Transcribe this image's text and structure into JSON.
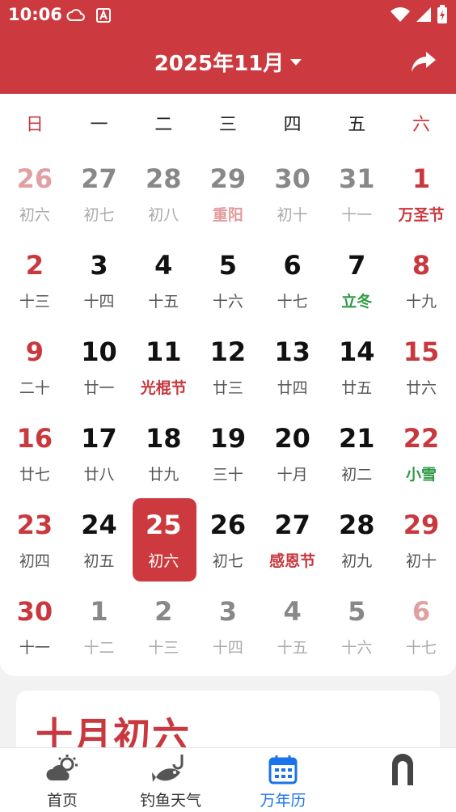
{
  "status": {
    "time": "10:06"
  },
  "header": {
    "title": "2025年11月"
  },
  "colors": {
    "brand": "#cc3a3f",
    "festival": "#c8383e",
    "solar_term": "#2e9a45",
    "nav_active": "#1a73e8"
  },
  "weekdays": [
    "日",
    "一",
    "二",
    "三",
    "四",
    "五",
    "六"
  ],
  "weeks": [
    [
      {
        "d": "26",
        "l": "初六",
        "other": true
      },
      {
        "d": "27",
        "l": "初七",
        "other": true
      },
      {
        "d": "28",
        "l": "初八",
        "other": true
      },
      {
        "d": "29",
        "l": "重阳",
        "other": true,
        "kind": "fest"
      },
      {
        "d": "30",
        "l": "初十",
        "other": true
      },
      {
        "d": "31",
        "l": "十一",
        "other": true
      },
      {
        "d": "1",
        "l": "万圣节",
        "kind": "fest"
      }
    ],
    [
      {
        "d": "2",
        "l": "十三"
      },
      {
        "d": "3",
        "l": "十四"
      },
      {
        "d": "4",
        "l": "十五"
      },
      {
        "d": "5",
        "l": "十六"
      },
      {
        "d": "6",
        "l": "十七"
      },
      {
        "d": "7",
        "l": "立冬",
        "kind": "term"
      },
      {
        "d": "8",
        "l": "十九"
      }
    ],
    [
      {
        "d": "9",
        "l": "二十"
      },
      {
        "d": "10",
        "l": "廿一"
      },
      {
        "d": "11",
        "l": "光棍节",
        "kind": "fest"
      },
      {
        "d": "12",
        "l": "廿三"
      },
      {
        "d": "13",
        "l": "廿四"
      },
      {
        "d": "14",
        "l": "廿五"
      },
      {
        "d": "15",
        "l": "廿六"
      }
    ],
    [
      {
        "d": "16",
        "l": "廿七"
      },
      {
        "d": "17",
        "l": "廿八"
      },
      {
        "d": "18",
        "l": "廿九"
      },
      {
        "d": "19",
        "l": "三十"
      },
      {
        "d": "20",
        "l": "十月"
      },
      {
        "d": "21",
        "l": "初二"
      },
      {
        "d": "22",
        "l": "小雪",
        "kind": "term"
      }
    ],
    [
      {
        "d": "23",
        "l": "初四"
      },
      {
        "d": "24",
        "l": "初五"
      },
      {
        "d": "25",
        "l": "初六",
        "selected": true
      },
      {
        "d": "26",
        "l": "初七"
      },
      {
        "d": "27",
        "l": "感恩节",
        "kind": "fest"
      },
      {
        "d": "28",
        "l": "初九"
      },
      {
        "d": "29",
        "l": "初十"
      }
    ],
    [
      {
        "d": "30",
        "l": "十一"
      },
      {
        "d": "1",
        "l": "十二",
        "other": true
      },
      {
        "d": "2",
        "l": "十三",
        "other": true
      },
      {
        "d": "3",
        "l": "十四",
        "other": true
      },
      {
        "d": "4",
        "l": "十五",
        "other": true
      },
      {
        "d": "5",
        "l": "十六",
        "other": true
      },
      {
        "d": "6",
        "l": "十七",
        "other": true
      }
    ]
  ],
  "lunar_card": {
    "title": "十月初六"
  },
  "nav": [
    {
      "label": "首页",
      "icon": "weather-cloud-sun-icon"
    },
    {
      "label": "钓鱼天气",
      "icon": "fish-hook-icon"
    },
    {
      "label": "万年历",
      "icon": "calendar-icon",
      "active": true
    },
    {
      "label": "",
      "icon": "arch-icon"
    }
  ]
}
